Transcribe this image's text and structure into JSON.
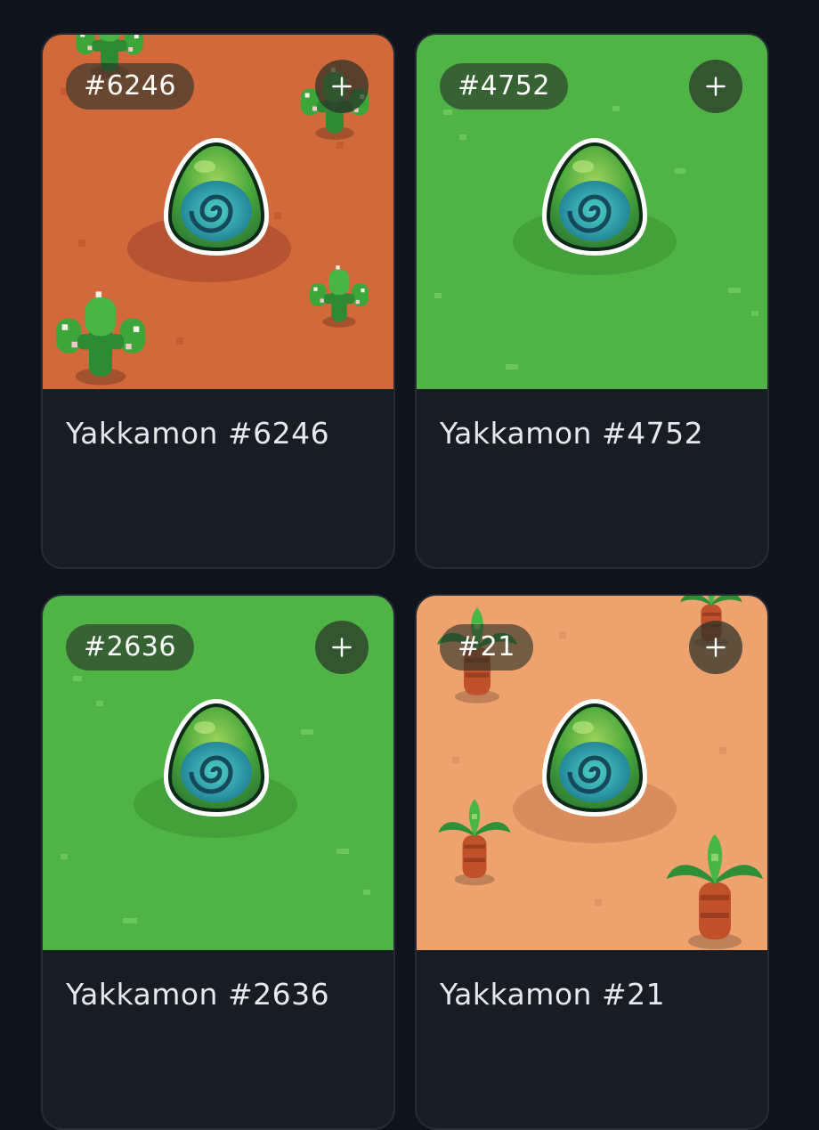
{
  "cards": [
    {
      "badge": "#6246",
      "name": "Yakkamon #6246",
      "background": "desert",
      "bg_color": "#d2693b",
      "add_icon": "plus-icon"
    },
    {
      "badge": "#4752",
      "name": "Yakkamon #4752",
      "background": "grass",
      "bg_color": "#4fb345",
      "add_icon": "plus-icon"
    },
    {
      "badge": "#2636",
      "name": "Yakkamon #2636",
      "background": "grass",
      "bg_color": "#4fb345",
      "add_icon": "plus-icon"
    },
    {
      "badge": "#21",
      "name": "Yakkamon #21",
      "background": "sand",
      "bg_color": "#eea26e",
      "add_icon": "plus-icon"
    }
  ],
  "colors": {
    "page_bg": "#0f131b",
    "card_bg": "#181c25",
    "card_border": "#262b36",
    "egg_green": "#3fa33a",
    "egg_teal": "#2fa3a8"
  }
}
